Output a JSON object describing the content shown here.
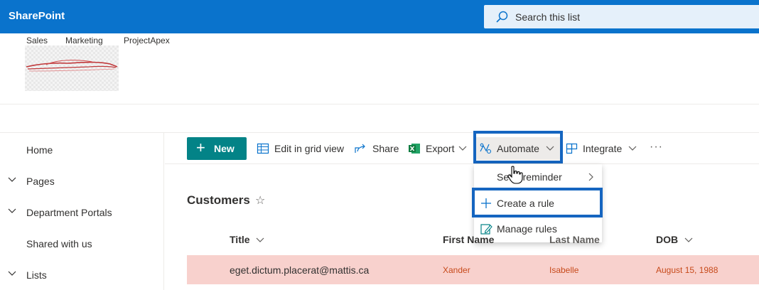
{
  "suite": {
    "brand": "SharePoint",
    "search_placeholder": "Search this list"
  },
  "site_nav": [
    "Sales",
    "Marketing",
    "ProjectApex"
  ],
  "left_nav": [
    {
      "label": "Home",
      "expandable": false
    },
    {
      "label": "Pages",
      "expandable": true
    },
    {
      "label": "Department Portals",
      "expandable": true
    },
    {
      "label": "Shared with us",
      "expandable": false
    },
    {
      "label": "Lists",
      "expandable": true
    }
  ],
  "commands": {
    "new": "New",
    "edit_grid": "Edit in grid view",
    "share": "Share",
    "export": "Export",
    "automate": "Automate",
    "integrate": "Integrate",
    "more": "···"
  },
  "automate_menu": {
    "set_reminder": "Set a reminder",
    "create_rule": "Create a rule",
    "manage_rules": "Manage rules"
  },
  "list": {
    "title": "Customers",
    "columns": [
      "Title",
      "First Name",
      "Last Name",
      "DOB"
    ],
    "rows": [
      {
        "title": "eget.dictum.placerat@mattis.ca",
        "first_name": "Xander",
        "last_name": "Isabelle",
        "dob": "August 15, 1988"
      }
    ]
  },
  "colors": {
    "suite_bar": "#0a73cc",
    "new_button": "#038387",
    "highlight_border": "#1565c0",
    "row_highlight": "#f8d1cd"
  }
}
